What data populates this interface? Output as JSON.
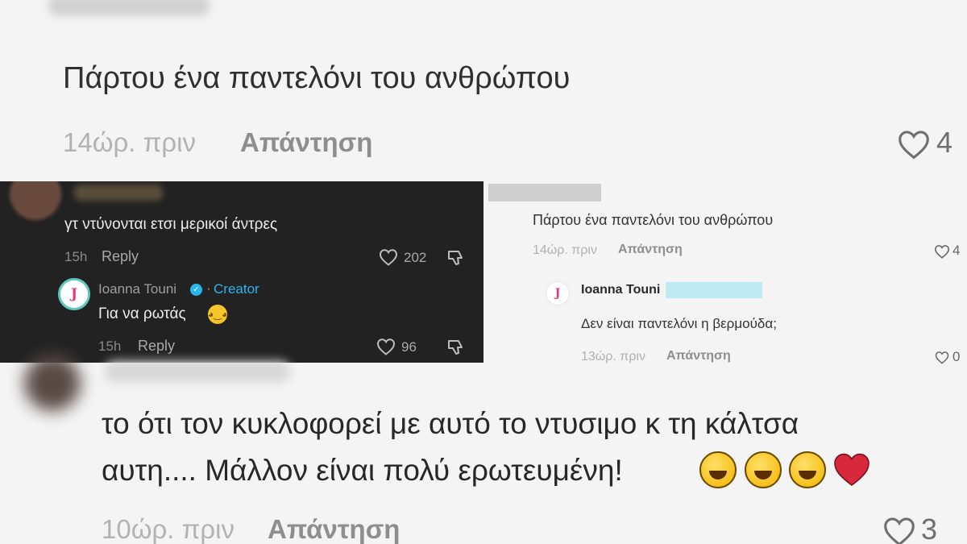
{
  "top_comment": {
    "text": "Πάρτου ένα παντελόνι του ανθρώπου",
    "time": "14ώρ. πριν",
    "reply_label": "Απάντηση",
    "likes": "4"
  },
  "dark_panel": {
    "comment": {
      "text": "γτ ντύνονται ετσι μερικοί άντρες",
      "time": "15h",
      "reply_label": "Reply",
      "likes": "202"
    },
    "reply": {
      "avatar_letter": "J",
      "name": "Ioanna Touni",
      "dot": "·",
      "badge": "Creator",
      "text": "Για να ρωτάς",
      "time": "15h",
      "reply_label": "Reply",
      "likes": "96"
    }
  },
  "right_panel": {
    "comment": {
      "text": "Πάρτου ένα παντελόνι του ανθρώπου",
      "time": "14ώρ. πριν",
      "reply_label": "Απάντηση",
      "likes": "4"
    },
    "reply": {
      "avatar_letter": "J",
      "name": "Ioanna Touni",
      "text": "Δεν είναι παντελόνι η βερμούδα;",
      "time": "13ώρ. πριν",
      "reply_label": "Απάντηση",
      "likes": "0"
    }
  },
  "bottom_comment": {
    "line1": "το ότι τον κυκλοφορεί με αυτό το ντυσιμο κ τη κάλτσα",
    "line2": "αυτη.... Μάλλον είναι πολύ ερωτευμένη!",
    "time": "10ώρ. πριν",
    "reply_label": "Απάντηση",
    "likes": "3"
  },
  "icons": {
    "heart": "heart-outline-icon",
    "dislike": "thumbs-down-icon",
    "verified": "verified-check-icon",
    "laugh": "rolling-laughing-emoji",
    "red_heart": "red-heart-emoji"
  },
  "colors": {
    "background": "#f4f4f4",
    "dark_panel": "#222222",
    "creator_accent": "#27b6ef",
    "avatar_letter": "#e0397c",
    "heart_red": "#d8283c"
  }
}
